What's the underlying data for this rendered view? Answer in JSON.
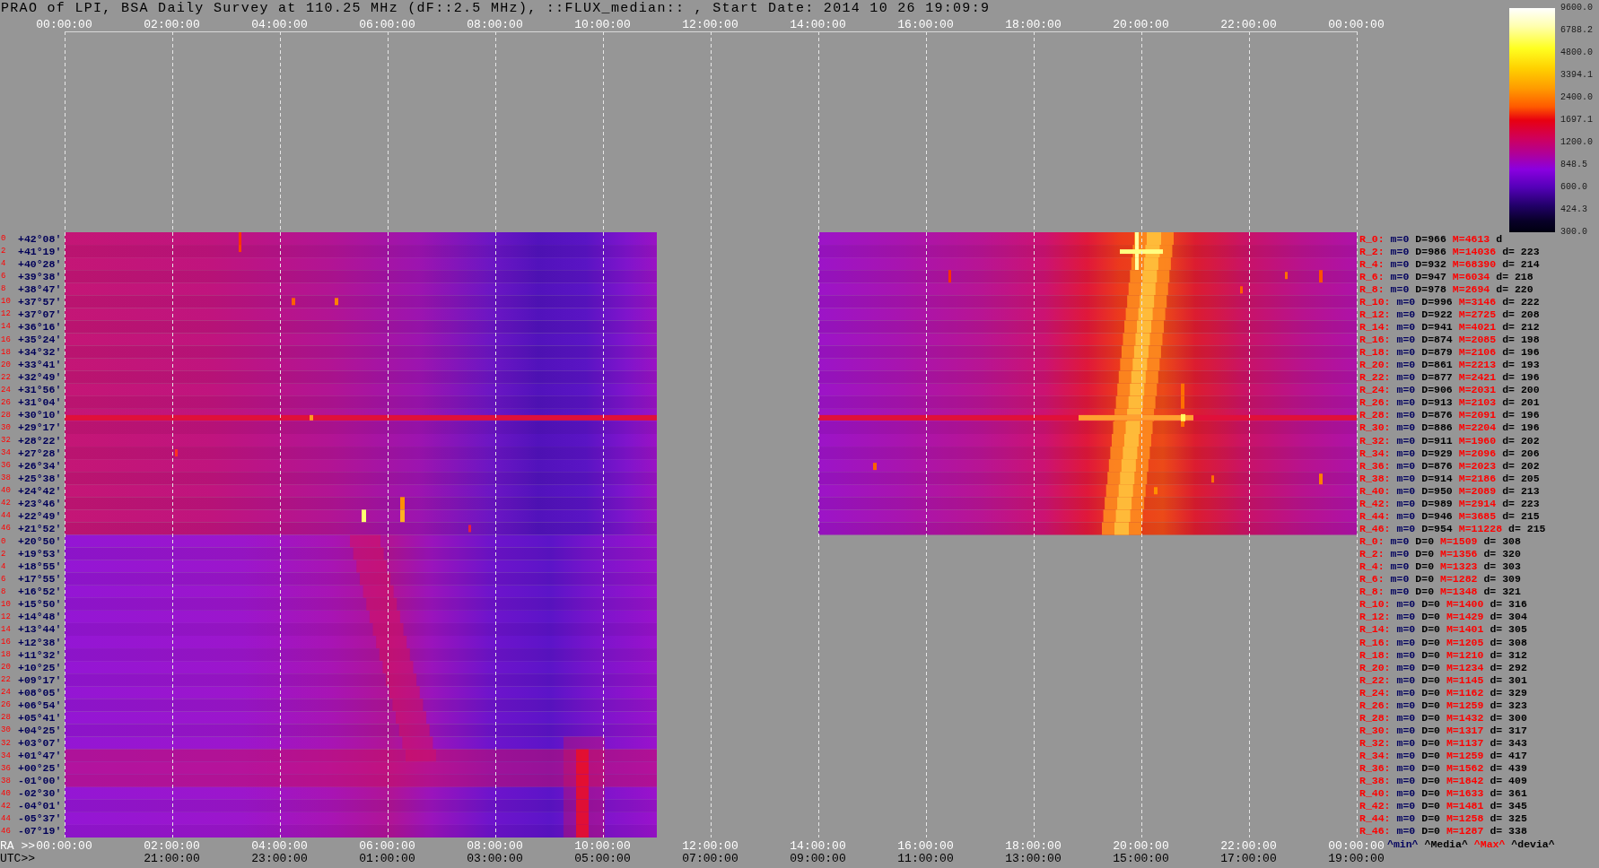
{
  "title": "PRAO of LPI, BSA Daily Survey at 110.25 MHz (dF::2.5 MHz), ::FLUX_median:: , Start Date: 2014 10 26 19:09:9",
  "top_axis": {
    "ticks": [
      "00:00:00",
      "02:00:00",
      "04:00:00",
      "06:00:00",
      "08:00:00",
      "10:00:00",
      "12:00:00",
      "14:00:00",
      "16:00:00",
      "18:00:00",
      "20:00:00",
      "22:00:00",
      "00:00:00"
    ]
  },
  "colorbar": {
    "labels": [
      "9600.0",
      "6788.2",
      "4800.0",
      "3394.1",
      "2400.0",
      "1697.1",
      "1200.0",
      "848.5",
      "600.0",
      "424.3",
      "300.0"
    ]
  },
  "declination_rows": [
    {
      "index": "0",
      "label": "+42°08'"
    },
    {
      "index": "2",
      "label": "+41°19'"
    },
    {
      "index": "4",
      "label": "+40°28'"
    },
    {
      "index": "6",
      "label": "+39°38'"
    },
    {
      "index": "8",
      "label": "+38°47'"
    },
    {
      "index": "10",
      "label": "+37°57'"
    },
    {
      "index": "12",
      "label": "+37°07'"
    },
    {
      "index": "14",
      "label": "+36°16'"
    },
    {
      "index": "16",
      "label": "+35°24'"
    },
    {
      "index": "18",
      "label": "+34°32'"
    },
    {
      "index": "20",
      "label": "+33°41'"
    },
    {
      "index": "22",
      "label": "+32°49'"
    },
    {
      "index": "24",
      "label": "+31°56'"
    },
    {
      "index": "26",
      "label": "+31°04'"
    },
    {
      "index": "28",
      "label": "+30°10'"
    },
    {
      "index": "30",
      "label": "+29°17'"
    },
    {
      "index": "32",
      "label": "+28°22'"
    },
    {
      "index": "34",
      "label": "+27°28'"
    },
    {
      "index": "36",
      "label": "+26°34'"
    },
    {
      "index": "38",
      "label": "+25°38'"
    },
    {
      "index": "40",
      "label": "+24°42'"
    },
    {
      "index": "42",
      "label": "+23°46'"
    },
    {
      "index": "44",
      "label": "+22°49'"
    },
    {
      "index": "46",
      "label": "+21°52'"
    },
    {
      "index": "0",
      "label": "+20°50'"
    },
    {
      "index": "2",
      "label": "+19°53'"
    },
    {
      "index": "4",
      "label": "+18°55'"
    },
    {
      "index": "6",
      "label": "+17°55'"
    },
    {
      "index": "8",
      "label": "+16°52'"
    },
    {
      "index": "10",
      "label": "+15°50'"
    },
    {
      "index": "12",
      "label": "+14°48'"
    },
    {
      "index": "14",
      "label": "+13°44'"
    },
    {
      "index": "16",
      "label": "+12°38'"
    },
    {
      "index": "18",
      "label": "+11°32'"
    },
    {
      "index": "20",
      "label": "+10°25'"
    },
    {
      "index": "22",
      "label": "+09°17'"
    },
    {
      "index": "24",
      "label": "+08°05'"
    },
    {
      "index": "26",
      "label": "+06°54'"
    },
    {
      "index": "28",
      "label": "+05°41'"
    },
    {
      "index": "30",
      "label": "+04°25'"
    },
    {
      "index": "32",
      "label": "+03°07'"
    },
    {
      "index": "34",
      "label": "+01°47'"
    },
    {
      "index": "36",
      "label": "+00°25'"
    },
    {
      "index": "38",
      "label": "-01°00'"
    },
    {
      "index": "40",
      "label": "-02°30'"
    },
    {
      "index": "42",
      "label": "-04°01'"
    },
    {
      "index": "44",
      "label": "-05°37'"
    },
    {
      "index": "46",
      "label": "-07°19'"
    }
  ],
  "stats_rows": [
    {
      "beam": "R_0:",
      "min": "m=0",
      "median": "D=966",
      "max": "M=4613",
      "dev": "d"
    },
    {
      "beam": "R_2:",
      "min": "m=0",
      "median": "D=986",
      "max": "M=14036",
      "dev": "d= 223"
    },
    {
      "beam": "R_4:",
      "min": "m=0",
      "median": "D=932",
      "max": "M=68390",
      "dev": "d= 214"
    },
    {
      "beam": "R_6:",
      "min": "m=0",
      "median": "D=947",
      "max": "M=6034",
      "dev": "d= 218"
    },
    {
      "beam": "R_8:",
      "min": "m=0",
      "median": "D=978",
      "max": "M=2694",
      "dev": "d= 220"
    },
    {
      "beam": "R_10:",
      "min": "m=0",
      "median": "D=996",
      "max": "M=3146",
      "dev": "d= 222"
    },
    {
      "beam": "R_12:",
      "min": "m=0",
      "median": "D=922",
      "max": "M=2725",
      "dev": "d= 208"
    },
    {
      "beam": "R_14:",
      "min": "m=0",
      "median": "D=941",
      "max": "M=4021",
      "dev": "d= 212"
    },
    {
      "beam": "R_16:",
      "min": "m=0",
      "median": "D=874",
      "max": "M=2085",
      "dev": "d= 198"
    },
    {
      "beam": "R_18:",
      "min": "m=0",
      "median": "D=879",
      "max": "M=2106",
      "dev": "d= 196"
    },
    {
      "beam": "R_20:",
      "min": "m=0",
      "median": "D=861",
      "max": "M=2213",
      "dev": "d= 193"
    },
    {
      "beam": "R_22:",
      "min": "m=0",
      "median": "D=877",
      "max": "M=2421",
      "dev": "d= 196"
    },
    {
      "beam": "R_24:",
      "min": "m=0",
      "median": "D=906",
      "max": "M=2031",
      "dev": "d= 200"
    },
    {
      "beam": "R_26:",
      "min": "m=0",
      "median": "D=913",
      "max": "M=2103",
      "dev": "d= 201"
    },
    {
      "beam": "R_28:",
      "min": "m=0",
      "median": "D=876",
      "max": "M=2091",
      "dev": "d= 196"
    },
    {
      "beam": "R_30:",
      "min": "m=0",
      "median": "D=886",
      "max": "M=2204",
      "dev": "d= 196"
    },
    {
      "beam": "R_32:",
      "min": "m=0",
      "median": "D=911",
      "max": "M=1960",
      "dev": "d= 202"
    },
    {
      "beam": "R_34:",
      "min": "m=0",
      "median": "D=929",
      "max": "M=2096",
      "dev": "d= 206"
    },
    {
      "beam": "R_36:",
      "min": "m=0",
      "median": "D=876",
      "max": "M=2023",
      "dev": "d= 202"
    },
    {
      "beam": "R_38:",
      "min": "m=0",
      "median": "D=914",
      "max": "M=2186",
      "dev": "d= 205"
    },
    {
      "beam": "R_40:",
      "min": "m=0",
      "median": "D=950",
      "max": "M=2089",
      "dev": "d= 213"
    },
    {
      "beam": "R_42:",
      "min": "m=0",
      "median": "D=989",
      "max": "M=2914",
      "dev": "d= 223"
    },
    {
      "beam": "R_44:",
      "min": "m=0",
      "median": "D=946",
      "max": "M=3685",
      "dev": "d= 215"
    },
    {
      "beam": "R_46:",
      "min": "m=0",
      "median": "D=954",
      "max": "M=11228",
      "dev": "d= 215"
    },
    {
      "beam": "R_0:",
      "min": "m=0",
      "median": "D=0",
      "max": "M=1509",
      "dev": "d= 308"
    },
    {
      "beam": "R_2:",
      "min": "m=0",
      "median": "D=0",
      "max": "M=1356",
      "dev": "d= 320"
    },
    {
      "beam": "R_4:",
      "min": "m=0",
      "median": "D=0",
      "max": "M=1323",
      "dev": "d= 303"
    },
    {
      "beam": "R_6:",
      "min": "m=0",
      "median": "D=0",
      "max": "M=1282",
      "dev": "d= 309"
    },
    {
      "beam": "R_8:",
      "min": "m=0",
      "median": "D=0",
      "max": "M=1348",
      "dev": "d= 321"
    },
    {
      "beam": "R_10:",
      "min": "m=0",
      "median": "D=0",
      "max": "M=1400",
      "dev": "d= 316"
    },
    {
      "beam": "R_12:",
      "min": "m=0",
      "median": "D=0",
      "max": "M=1429",
      "dev": "d= 304"
    },
    {
      "beam": "R_14:",
      "min": "m=0",
      "median": "D=0",
      "max": "M=1401",
      "dev": "d= 305"
    },
    {
      "beam": "R_16:",
      "min": "m=0",
      "median": "D=0",
      "max": "M=1205",
      "dev": "d= 308"
    },
    {
      "beam": "R_18:",
      "min": "m=0",
      "median": "D=0",
      "max": "M=1210",
      "dev": "d= 312"
    },
    {
      "beam": "R_20:",
      "min": "m=0",
      "median": "D=0",
      "max": "M=1234",
      "dev": "d= 292"
    },
    {
      "beam": "R_22:",
      "min": "m=0",
      "median": "D=0",
      "max": "M=1145",
      "dev": "d= 301"
    },
    {
      "beam": "R_24:",
      "min": "m=0",
      "median": "D=0",
      "max": "M=1162",
      "dev": "d= 329"
    },
    {
      "beam": "R_26:",
      "min": "m=0",
      "median": "D=0",
      "max": "M=1259",
      "dev": "d= 323"
    },
    {
      "beam": "R_28:",
      "min": "m=0",
      "median": "D=0",
      "max": "M=1432",
      "dev": "d= 300"
    },
    {
      "beam": "R_30:",
      "min": "m=0",
      "median": "D=0",
      "max": "M=1317",
      "dev": "d= 317"
    },
    {
      "beam": "R_32:",
      "min": "m=0",
      "median": "D=0",
      "max": "M=1137",
      "dev": "d= 343"
    },
    {
      "beam": "R_34:",
      "min": "m=0",
      "median": "D=0",
      "max": "M=1259",
      "dev": "d= 417"
    },
    {
      "beam": "R_36:",
      "min": "m=0",
      "median": "D=0",
      "max": "M=1562",
      "dev": "d= 439"
    },
    {
      "beam": "R_38:",
      "min": "m=0",
      "median": "D=0",
      "max": "M=1842",
      "dev": "d= 409"
    },
    {
      "beam": "R_40:",
      "min": "m=0",
      "median": "D=0",
      "max": "M=1633",
      "dev": "d= 361"
    },
    {
      "beam": "R_42:",
      "min": "m=0",
      "median": "D=0",
      "max": "M=1481",
      "dev": "d= 345"
    },
    {
      "beam": "R_44:",
      "min": "m=0",
      "median": "D=0",
      "max": "M=1258",
      "dev": "d= 325"
    },
    {
      "beam": "R_46:",
      "min": "m=0",
      "median": "D=0",
      "max": "M=1287",
      "dev": "d= 338"
    }
  ],
  "stats_legend": [
    {
      "kind": "min",
      "text": "^min^"
    },
    {
      "kind": "median",
      "text": "^Media^"
    },
    {
      "kind": "max",
      "text": "^Max^"
    },
    {
      "kind": "dev",
      "text": "^devia^"
    }
  ],
  "bottom_axis": {
    "ra_label": "RA >>",
    "ra_ticks": [
      "00:00:00",
      "02:00:00",
      "04:00:00",
      "06:00:00",
      "08:00:00",
      "10:00:00",
      "12:00:00",
      "14:00:00",
      "16:00:00",
      "18:00:00",
      "20:00:00",
      "22:00:00",
      "00:00:00"
    ],
    "utc_label": "UTC>>",
    "utc_ticks": [
      "21:00:00",
      "23:00:00",
      "01:00:00",
      "03:00:00",
      "05:00:00",
      "07:00:00",
      "09:00:00",
      "11:00:00",
      "13:00:00",
      "15:00:00",
      "17:00:00",
      "19:00:00"
    ]
  }
}
